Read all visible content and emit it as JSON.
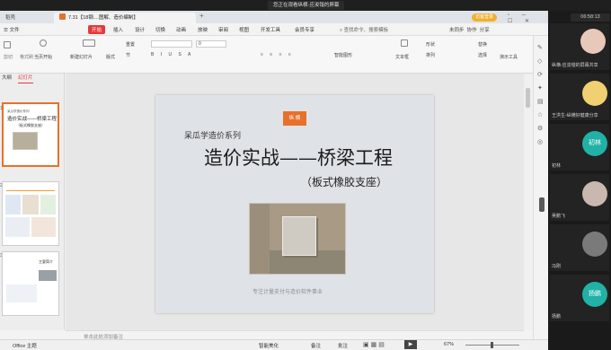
{
  "share_bar": {
    "text": "您正在观看纵横-应浚锴的屏幕"
  },
  "clock": "06:58:13",
  "tabs": {
    "home": "稻壳",
    "doc": "7.31【18钢....图解、造价编制】",
    "add": "+",
    "login": "访客登录"
  },
  "menu": {
    "items": [
      "开始",
      "插入",
      "设计",
      "切换",
      "动画",
      "放映",
      "审阅",
      "视图",
      "开发工具",
      "会员专享"
    ],
    "search": "查找命令、搜索模板",
    "right": [
      "未同步",
      "协作",
      "分享"
    ]
  },
  "ribbon": {
    "labels": [
      "当页开始",
      "新建幻灯片",
      "版式",
      "重置",
      "节",
      "文本框",
      "形状",
      "排列",
      "演示工具",
      "替换",
      "选择",
      "智能图形"
    ],
    "font_size": "0",
    "paste_hint": "剪切",
    "format_hint": "格式刷"
  },
  "left_panel": {
    "tab_outline": "大纲",
    "tab_slides": "幻灯片",
    "slide_numbers": [
      "1",
      "2",
      "3"
    ]
  },
  "thumbnails": {
    "t1_series": "呆瓜学造价系列",
    "t1_title": "造价实战——桥梁工程",
    "t1_sub": "（板式橡胶支座）",
    "t3_title": "主要简介"
  },
  "slide": {
    "logo": "纵 横",
    "series": "呆瓜学造价系列",
    "title": "造价实战——桥梁工程",
    "subtitle": "（板式橡胶支座）",
    "footer": "专注计量支付与造价软件事业"
  },
  "notes_placeholder": "单击此处添加备注",
  "status": {
    "theme": "Office 主题",
    "smart": "智能美化",
    "notes": "备注",
    "comments": "批注",
    "zoom": "67%"
  },
  "participants": [
    {
      "name": "纵横-应浚锴的屏幕共享"
    },
    {
      "name": "王洪生-纵横好健康分享"
    },
    {
      "name": "初林"
    },
    {
      "name": "吴鹏飞"
    },
    {
      "name": "冯刚"
    },
    {
      "name": "扬鹏"
    }
  ],
  "avatar_initials": {
    "p3": "初林",
    "p6": "扬鹏"
  },
  "colors": {
    "accent": "#e4393c",
    "orange": "#e8702a",
    "login": "#f0b030",
    "teal_avatar": "#21b1a6"
  }
}
